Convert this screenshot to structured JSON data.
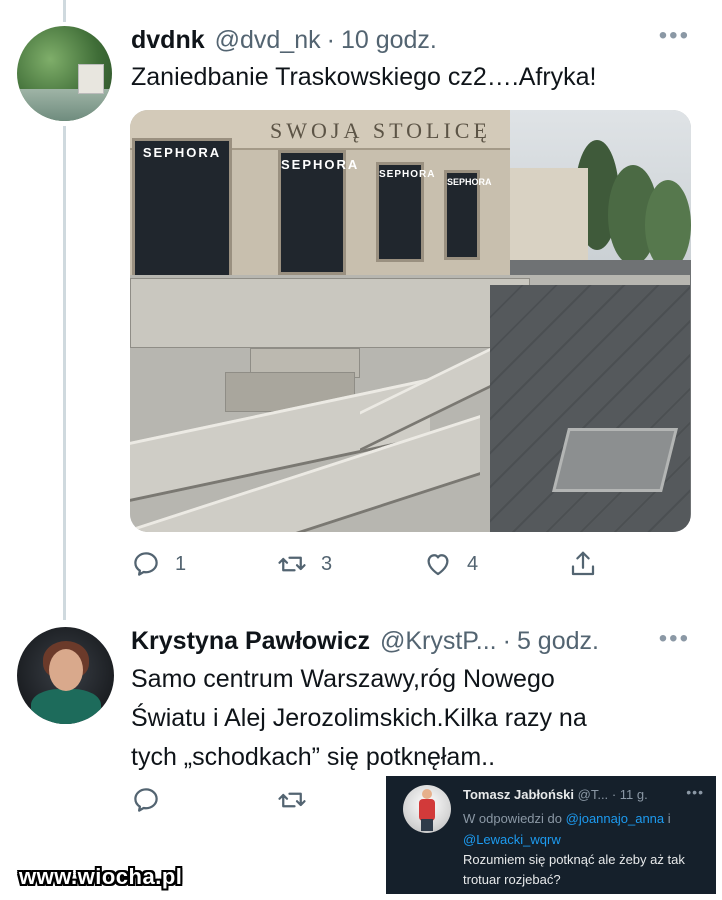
{
  "tweet1": {
    "author_name": "dvdnk",
    "handle": "@dvd_nk",
    "separator": "·",
    "time": "10 godz.",
    "more_label": "•••",
    "text": "Zaniedbanie Traskowskiego cz2….Afryka!",
    "image": {
      "sign_text": "SWOJĄ STOLICĘ",
      "store_label": "SEPHORA"
    },
    "actions": {
      "reply_icon": "reply-icon",
      "reply_count": "1",
      "retweet_icon": "retweet-icon",
      "retweet_count": "3",
      "like_icon": "like-icon",
      "like_count": "4",
      "share_icon": "share-icon"
    }
  },
  "tweet2": {
    "author_name": "Krystyna Pawłowicz",
    "handle": "@KrystP...",
    "separator": "·",
    "time": "5 godz.",
    "more_label": "•••",
    "text_lines": [
      "Samo centrum Warszawy,róg Nowego",
      "Światu i Alej Jerozolimskich.Kilka razy na",
      "tych „schodkach” się potknęłam.."
    ],
    "actions": {
      "reply_icon": "reply-icon",
      "retweet_icon": "retweet-icon"
    }
  },
  "quoted_reply": {
    "author_name": "Tomasz Jabłoński",
    "handle": "@T...",
    "separator": "·",
    "time": "11 g.",
    "more_label": "•••",
    "reply_prefix": "W odpowiedzi do",
    "reply_user1": "@joannajo_anna",
    "reply_joiner": "i",
    "reply_user2": "@Lewacki_wqrw",
    "text": "Rozumiem się potknąć ale żeby aż tak trotuar rozjebać?"
  },
  "watermark": "www.wiocha.pl",
  "colors": {
    "text_primary": "#0f1419",
    "text_secondary": "#536471",
    "thread_line": "#cfd9de",
    "dark_bg": "#15202b",
    "link_blue": "#1d9bf0"
  }
}
